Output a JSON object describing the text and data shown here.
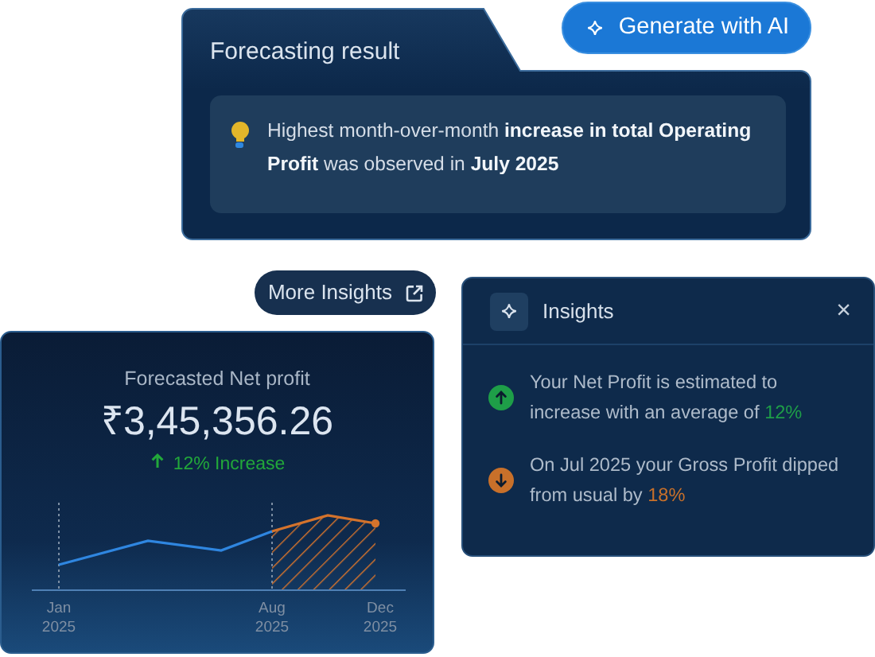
{
  "forecast_card": {
    "title": "Forecasting result",
    "message": "Highest month-over-month **increase in total Operating Profit** was observed in **July 2025**"
  },
  "generate_button": {
    "label": "Generate with AI"
  },
  "more_insights_button": {
    "label": "More Insights"
  },
  "net_profit_card": {
    "title": "Forecasted Net profit",
    "value": "₹3,45,356.26",
    "change": {
      "text": "12% Increase",
      "rising": true
    },
    "chart": {
      "x_labels": [
        {
          "month": "Jan",
          "year": "2025"
        },
        {
          "month": "Aug",
          "year": "2025"
        },
        {
          "month": "Dec",
          "year": "2025"
        }
      ]
    }
  },
  "insights_panel": {
    "title": "Insights",
    "close": "×",
    "items": [
      {
        "rising": true,
        "text": "Your Net Profit is estimated to increase with an average of ",
        "highlight": "12%"
      },
      {
        "rising": false,
        "text": "On Jul 2025 your Gross Profit dipped from usual by ",
        "highlight": "18%"
      }
    ]
  }
}
